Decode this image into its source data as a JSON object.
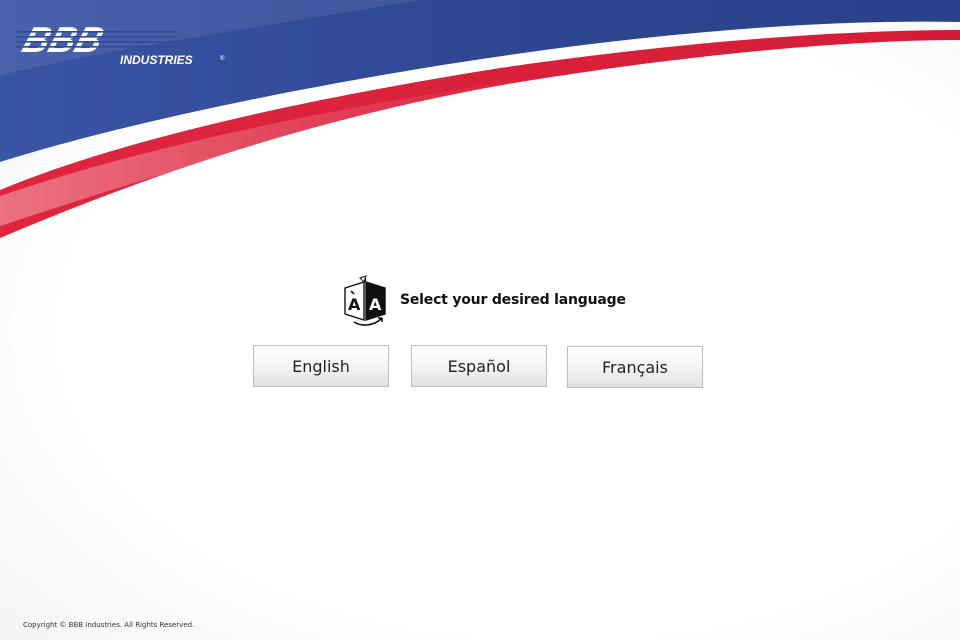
{
  "brand": {
    "logo_text": "BBB",
    "logo_subtext": "INDUSTRIES",
    "registered_mark": "®",
    "colors": {
      "blue": "#2f4a96",
      "red": "#d91f3c",
      "white": "#ffffff"
    }
  },
  "language_prompt": {
    "icon": "language-translate-icon",
    "text": "Select your desired language"
  },
  "languages": [
    {
      "label": "English"
    },
    {
      "label": "Español"
    },
    {
      "label": "Français"
    }
  ],
  "footer": {
    "copyright": "Copyright © BBB Industries. All Rights Reserved."
  }
}
